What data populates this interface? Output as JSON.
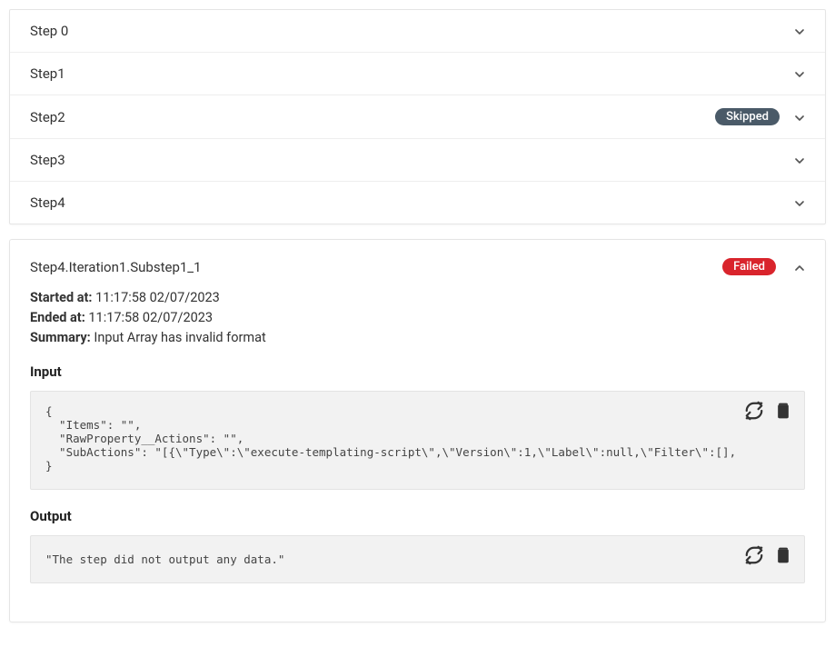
{
  "steps": [
    {
      "label": "Step 0",
      "badge": null
    },
    {
      "label": "Step1",
      "badge": null
    },
    {
      "label": "Step2",
      "badge": "Skipped"
    },
    {
      "label": "Step3",
      "badge": null
    },
    {
      "label": "Step4",
      "badge": null
    }
  ],
  "detail": {
    "title": "Step4.Iteration1.Substep1_1",
    "badge": "Failed",
    "started_label": "Started at:",
    "started_value": "11:17:58 02/07/2023",
    "ended_label": "Ended at:",
    "ended_value": "11:17:58 02/07/2023",
    "summary_label": "Summary:",
    "summary_value": "Input Array has invalid format",
    "input_heading": "Input",
    "input_code": "{\n  \"Items\": \"\",\n  \"RawProperty__Actions\": \"\",\n  \"SubActions\": \"[{\\\"Type\\\":\\\"execute-templating-script\\\",\\\"Version\\\":1,\\\"Label\\\":null,\\\"Filter\\\":[],\\\"Condition\\\":[{\\\"BodyPath\n}",
    "output_heading": "Output",
    "output_code": "\"The step did not output any data.\""
  }
}
